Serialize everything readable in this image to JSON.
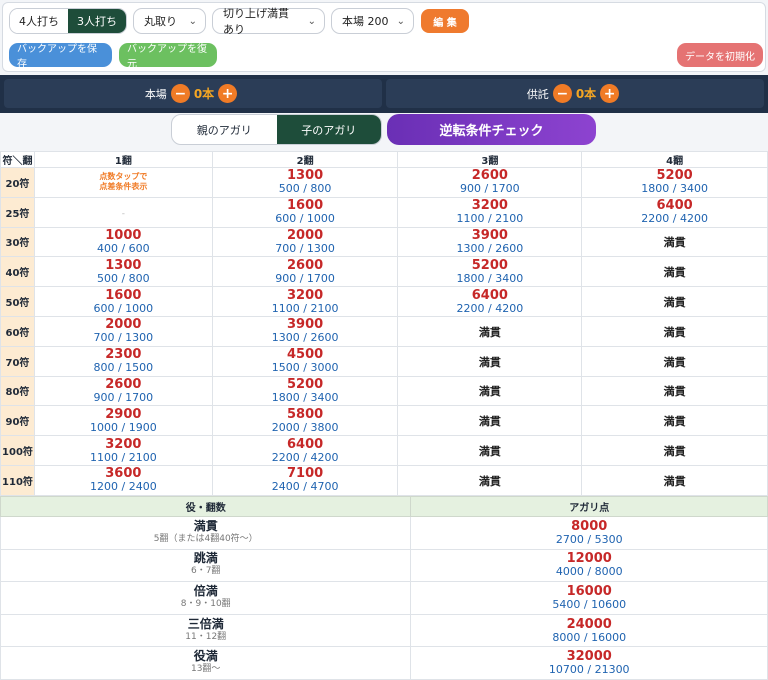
{
  "header": {
    "players": [
      "4人打ち",
      "3人打ち"
    ],
    "rounding": "丸取り",
    "kiriage": "切り上げ満貫あり",
    "honba": "本場 200",
    "edit": "編 集",
    "backup_save": "バックアップを保存",
    "backup_restore": "バックアップを復元",
    "reset": "データを初期化"
  },
  "counters": {
    "honba_label": "本場",
    "honba_value": "0本",
    "kyotaku_label": "供託",
    "kyotaku_value": "0本",
    "minus": "−",
    "plus": "+"
  },
  "tabs": {
    "oya": "親のアガリ",
    "ko": "子のアガリ",
    "reverse": "逆転条件チェック"
  },
  "grid": {
    "corner": "符＼翻",
    "cols": [
      "1翻",
      "2翻",
      "3翻",
      "4翻"
    ],
    "tip": [
      "点数タップで",
      "点差条件表示"
    ],
    "dash": "-",
    "rows": [
      {
        "fu": "20符",
        "cells": [
          null,
          {
            "p": "1300",
            "s": "500 / 800"
          },
          {
            "p": "2600",
            "s": "900 / 1700"
          },
          {
            "p": "5200",
            "s": "1800 / 3400"
          }
        ]
      },
      {
        "fu": "25符",
        "cells": [
          "-",
          {
            "p": "1600",
            "s": "600 / 1000"
          },
          {
            "p": "3200",
            "s": "1100 / 2100"
          },
          {
            "p": "6400",
            "s": "2200 / 4200"
          }
        ]
      },
      {
        "fu": "30符",
        "cells": [
          {
            "p": "1000",
            "s": "400 / 600"
          },
          {
            "p": "2000",
            "s": "700 / 1300"
          },
          {
            "p": "3900",
            "s": "1300 / 2600"
          },
          "満貫"
        ]
      },
      {
        "fu": "40符",
        "cells": [
          {
            "p": "1300",
            "s": "500 / 800"
          },
          {
            "p": "2600",
            "s": "900 / 1700"
          },
          {
            "p": "5200",
            "s": "1800 / 3400"
          },
          "満貫"
        ]
      },
      {
        "fu": "50符",
        "cells": [
          {
            "p": "1600",
            "s": "600 / 1000"
          },
          {
            "p": "3200",
            "s": "1100 / 2100"
          },
          {
            "p": "6400",
            "s": "2200 / 4200"
          },
          "満貫"
        ]
      },
      {
        "fu": "60符",
        "cells": [
          {
            "p": "2000",
            "s": "700 / 1300"
          },
          {
            "p": "3900",
            "s": "1300 / 2600"
          },
          "満貫",
          "満貫"
        ]
      },
      {
        "fu": "70符",
        "cells": [
          {
            "p": "2300",
            "s": "800 / 1500"
          },
          {
            "p": "4500",
            "s": "1500 / 3000"
          },
          "満貫",
          "満貫"
        ]
      },
      {
        "fu": "80符",
        "cells": [
          {
            "p": "2600",
            "s": "900 / 1700"
          },
          {
            "p": "5200",
            "s": "1800 / 3400"
          },
          "満貫",
          "満貫"
        ]
      },
      {
        "fu": "90符",
        "cells": [
          {
            "p": "2900",
            "s": "1000 / 1900"
          },
          {
            "p": "5800",
            "s": "2000 / 3800"
          },
          "満貫",
          "満貫"
        ]
      },
      {
        "fu": "100符",
        "cells": [
          {
            "p": "3200",
            "s": "1100 / 2100"
          },
          {
            "p": "6400",
            "s": "2200 / 4200"
          },
          "満貫",
          "満貫"
        ]
      },
      {
        "fu": "110符",
        "cells": [
          {
            "p": "3600",
            "s": "1200 / 2400"
          },
          {
            "p": "7100",
            "s": "2400 / 4700"
          },
          "満貫",
          "満貫"
        ]
      }
    ]
  },
  "yaku": {
    "head": [
      "役・翻数",
      "アガリ点"
    ],
    "rows": [
      {
        "name": "満貫",
        "desc": "5翻（または4翻40符〜）",
        "p": "8000",
        "s": "2700 / 5300"
      },
      {
        "name": "跳満",
        "desc": "6・7翻",
        "p": "12000",
        "s": "4000 / 8000"
      },
      {
        "name": "倍満",
        "desc": "8・9・10翻",
        "p": "16000",
        "s": "5400 / 10600"
      },
      {
        "name": "三倍満",
        "desc": "11・12翻",
        "p": "24000",
        "s": "8000 / 16000"
      },
      {
        "name": "役満",
        "desc": "13翻〜",
        "p": "32000",
        "s": "10700 / 21300"
      }
    ]
  }
}
